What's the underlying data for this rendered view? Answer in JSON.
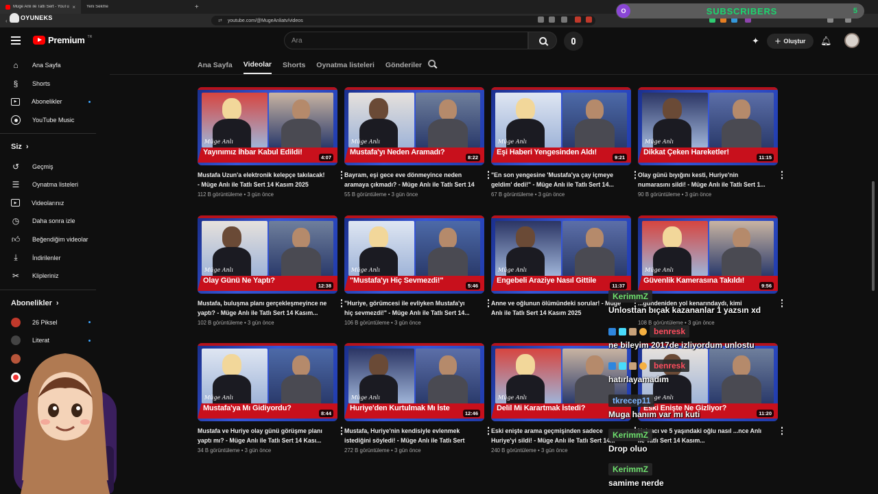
{
  "browser": {
    "active_tab": "Müge Anlı ile Tatlı Sert - YouTube",
    "second_tab": "Yeni Sekme",
    "url": "youtube.com/@MugeAnliatv/videos",
    "overlay_logo": "OYUNEKS"
  },
  "subscribers_widget": {
    "icon_letter": "O",
    "label": "SUBSCRIBERS",
    "count": "5"
  },
  "header": {
    "logo_text": "Premium",
    "logo_region": "TR",
    "search_placeholder": "Ara",
    "create_label": "Oluştur"
  },
  "sidebar": {
    "main": [
      {
        "label": "Ana Sayfa",
        "icon": "home-icon"
      },
      {
        "label": "Shorts",
        "icon": "shorts-icon"
      },
      {
        "label": "Abonelikler",
        "icon": "subscriptions-icon",
        "dot": true
      },
      {
        "label": "YouTube Music",
        "icon": "music-icon"
      }
    ],
    "you_heading": "Siz",
    "you": [
      {
        "label": "Geçmiş",
        "icon": "history-icon"
      },
      {
        "label": "Oynatma listeleri",
        "icon": "playlists-icon"
      },
      {
        "label": "Videolarınız",
        "icon": "your-videos-icon"
      },
      {
        "label": "Daha sonra izle",
        "icon": "clock-icon"
      },
      {
        "label": "Beğendiğim videolar",
        "icon": "like-icon"
      },
      {
        "label": "İndirilenler",
        "icon": "download-icon"
      },
      {
        "label": "Klipleriniz",
        "icon": "scissors-icon"
      }
    ],
    "subs_heading": "Abonelikler",
    "subs": [
      {
        "label": "26 Piksel",
        "dot": true
      },
      {
        "label": "Literat",
        "dot": true
      }
    ]
  },
  "tabs": [
    "Ana Sayfa",
    "Videolar",
    "Shorts",
    "Oynatma listeleri",
    "Gönderiler"
  ],
  "active_tab_index": 1,
  "videos": [
    {
      "banner": "Yayınımız İhbar Kabul Edildi!",
      "duration": "4:07",
      "title": "Mustafa Uzun'a elektronik kelepçe takılacak! - Müge Anlı ile Tatlı Sert 14 Kasım 2025",
      "views": "112 B görüntüleme",
      "age": "3 gün önce"
    },
    {
      "banner": "Mustafa'yı Neden Aramadı?",
      "duration": "8:22",
      "title": "Bayram, eşi gece eve dönmeyince neden aramaya çıkmadı? - Müge Anlı ile Tatlı Sert 14 ...",
      "views": "55 B görüntüleme",
      "age": "3 gün önce"
    },
    {
      "banner": "Eşi Haberi Yengesinden Aldı!",
      "duration": "9:21",
      "title": "\"En son yengesine 'Mustafa'ya çay içmeye geldim' dedi!\" - Müge Anlı ile Tatlı Sert 14...",
      "views": "67 B görüntüleme",
      "age": "3 gün önce"
    },
    {
      "banner": "Dikkat Çeken Hareketler!",
      "duration": "11:15",
      "title": "Olay günü bıyığını kesti, Huriye'nin numarasını sildi! - Müge Anlı ile Tatlı Sert 1...",
      "views": "90 B görüntüleme",
      "age": "3 gün önce"
    },
    {
      "banner": "Olay Günü Ne Yaptı?",
      "duration": "12:38",
      "title": "Mustafa, buluşma planı gerçekleşmeyince ne yaptı? - Müge Anlı ile Tatlı Sert 14 Kasım...",
      "views": "102 B görüntüleme",
      "age": "3 gün önce"
    },
    {
      "banner": "\"Mustafa'yı Hiç Sevmezdi!\"",
      "duration": "5:46",
      "title": "\"Huriye, görümcesi ile evliyken Mustafa'yı hiç sevmezdi!\" - Müge Anlı ile Tatlı Sert 14...",
      "views": "106 B görüntüleme",
      "age": "3 gün önce"
    },
    {
      "banner": "Engebeli Araziye Nasıl Gittile",
      "duration": "11:37",
      "title": "Anne ve oğlunun ölümündeki sorular! - Müge Anlı ile Tatlı Sert 14 Kasım 2025",
      "views": "",
      "age": ""
    },
    {
      "banner": "Güvenlik Kamerasına Takıldı!",
      "duration": "9:56",
      "title": "...gündeniden yol kenarındaydı, kimi",
      "views": "108 B görüntüleme",
      "age": "3 gün önce"
    },
    {
      "banner": "Mustafa'ya Mı Gidiyordu?",
      "duration": "8:44",
      "title": "Mustafa ve Huriye olay günü görüşme planı yaptı mı? - Müge Anlı ile Tatlı Sert 14 Kası...",
      "views": "34 B görüntüleme",
      "age": "3 gün önce"
    },
    {
      "banner": "Huriye'den Kurtulmak Mı İste",
      "duration": "12:46",
      "title": "Mustafa, Huriye'nin kendisiyle evlenmek istediğini söyledi! - Müge Anlı ile Tatlı Sert 1...",
      "views": "272 B görüntüleme",
      "age": "3 gün önce"
    },
    {
      "banner": "Delil Mi Karartmak İstedi?",
      "duration": "",
      "title": "Eski enişte arama geçmişinden sadece Huriye'yi sildi! - Müge Anlı ile Tatlı Sert 14...",
      "views": "240 B görüntüleme",
      "age": "3 gün önce"
    },
    {
      "banner": "Eski Enişte Ne Gizliyor?",
      "duration": "11:20",
      "title": "Helvacı ve 5 yaşındaki oğlu nasıl ...nce Anlı ile Tatlı Sert 14 Kasım...",
      "views": "",
      "age": ""
    }
  ],
  "chat": [
    {
      "user": "KerimmZ",
      "color": "#6ee06e",
      "message": "Unlosttan bıçak kazananlar 1 yazsın xd"
    },
    {
      "user": "benresk",
      "color": "#ff4d5e",
      "message": "ne bileyim 2017de izliyordum unlostu"
    },
    {
      "user": "benresk",
      "color": "#ff4d5e",
      "message": "hatırlayamadım"
    },
    {
      "user": "tkrecep11",
      "color": "#7fb7ff",
      "message": "Muga hanım var mı kuti"
    },
    {
      "user": "KerimmZ",
      "color": "#6ee06e",
      "message": "Drop oluo"
    },
    {
      "user": "KerimmZ",
      "color": "#6ee06e",
      "message": "samime nerde"
    }
  ]
}
